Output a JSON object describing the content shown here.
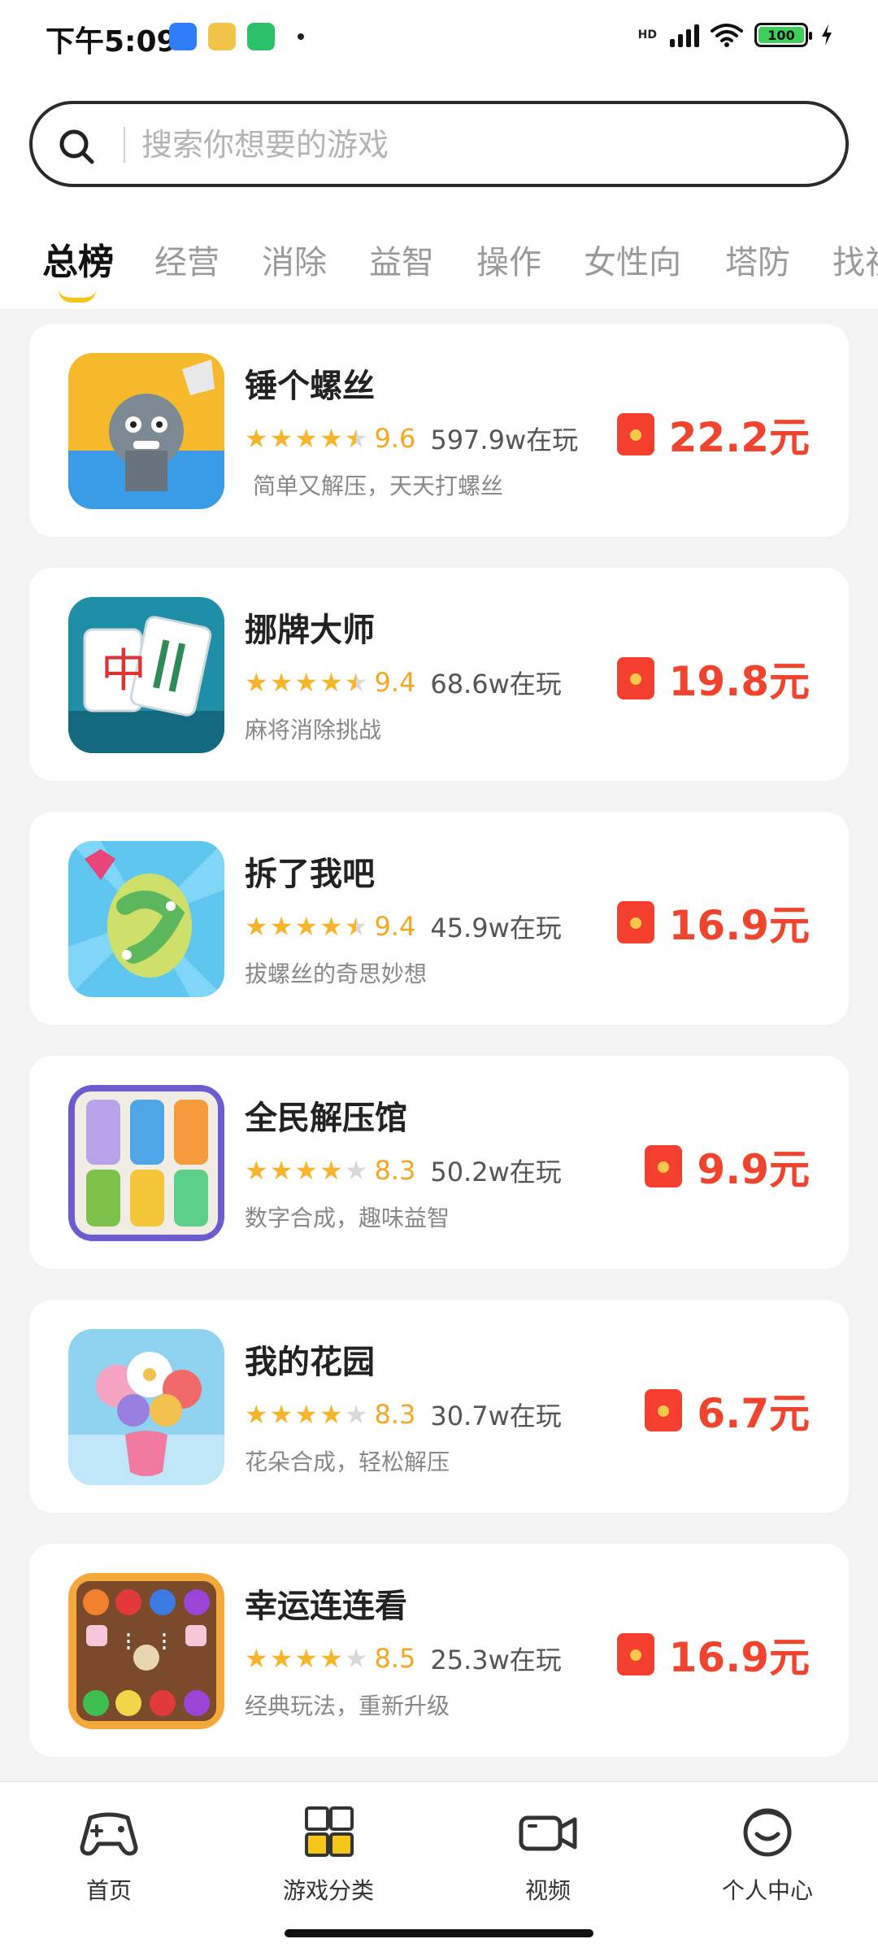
{
  "status_bar": {
    "time": "下午5:09",
    "battery": "100"
  },
  "search": {
    "placeholder": "搜索你想要的游戏"
  },
  "tabs": [
    {
      "label": "总榜",
      "active": true
    },
    {
      "label": "经营"
    },
    {
      "label": "消除"
    },
    {
      "label": "益智"
    },
    {
      "label": "操作"
    },
    {
      "label": "女性向"
    },
    {
      "label": "塔防"
    },
    {
      "label": "找视"
    }
  ],
  "games": [
    {
      "title": "锤个螺丝",
      "score": "9.6",
      "players": "597.9w在玩",
      "desc": "简单又解压，天天打螺丝",
      "reward": "22.2元",
      "stars": 4.5
    },
    {
      "title": "挪牌大师",
      "score": "9.4",
      "players": "68.6w在玩",
      "desc": "麻将消除挑战",
      "reward": "19.8元",
      "stars": 4.5
    },
    {
      "title": "拆了我吧",
      "score": "9.4",
      "players": "45.9w在玩",
      "desc": "拔螺丝的奇思妙想",
      "reward": "16.9元",
      "stars": 4.5
    },
    {
      "title": "全民解压馆",
      "score": "8.3",
      "players": "50.2w在玩",
      "desc": "数字合成，趣味益智",
      "reward": "9.9元",
      "stars": 4
    },
    {
      "title": "我的花园",
      "score": "8.3",
      "players": "30.7w在玩",
      "desc": "花朵合成，轻松解压",
      "reward": "6.7元",
      "stars": 4
    },
    {
      "title": "幸运连连看",
      "score": "8.5",
      "players": "25.3w在玩",
      "desc": "经典玩法，重新升级",
      "reward": "16.9元",
      "stars": 4
    }
  ],
  "bottom_nav": [
    {
      "label": "首页",
      "icon": "gamepad-icon"
    },
    {
      "label": "游戏分类",
      "icon": "grid-icon"
    },
    {
      "label": "视频",
      "icon": "video-camera-icon"
    },
    {
      "label": "个人中心",
      "icon": "smiley-icon"
    }
  ],
  "colors": {
    "accent": "#f5c518",
    "reward": "#f0442e",
    "star": "#f7b52b"
  }
}
